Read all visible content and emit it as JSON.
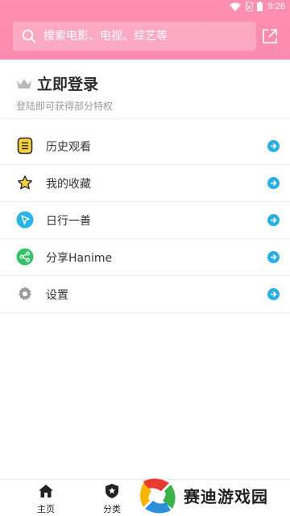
{
  "status_bar": {
    "time": "9:26"
  },
  "search": {
    "placeholder": "搜索电影、电视、综艺等"
  },
  "login": {
    "title": "立即登录",
    "subtitle": "登陆即可获得部分特权"
  },
  "menu": [
    {
      "label": "历史观看",
      "icon": "history-icon"
    },
    {
      "label": "我的收藏",
      "icon": "star-icon"
    },
    {
      "label": "日行一善",
      "icon": "cursor-icon"
    },
    {
      "label": "分享Hanime",
      "icon": "share-icon"
    },
    {
      "label": "设置",
      "icon": "gear-icon"
    }
  ],
  "bottom_nav": [
    {
      "label": "主页",
      "icon": "home-icon"
    },
    {
      "label": "分类",
      "icon": "category-icon"
    }
  ],
  "watermark": {
    "text": "赛迪游戏园"
  },
  "colors": {
    "header": "#ff8fb1",
    "arrow": "#29aee6",
    "share_green": "#35c06a",
    "cursor_blue": "#29b6e6"
  }
}
